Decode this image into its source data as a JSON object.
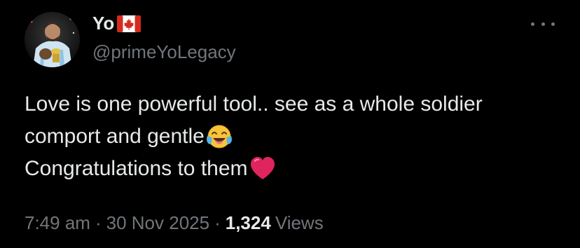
{
  "author": {
    "display_name": "Yo",
    "flag_icon": "canada-flag-icon",
    "handle": "@primeYoLegacy",
    "avatar_icon": "profile-photo"
  },
  "tweet": {
    "lines": [
      "Love is one powerful tool.. see as a whole soldier",
      "comport and gentle",
      "Congratulations to them"
    ],
    "emoji": [
      "tears-of-joy-emoji",
      "red-heart-emoji"
    ]
  },
  "meta": {
    "time": "7:49 am",
    "separator": "·",
    "date": "30 Nov 2025",
    "views_count": "1,324",
    "views_label": "Views"
  },
  "colors": {
    "background": "#000000",
    "primary_text": "#e7e9ea",
    "secondary_text": "#71767b",
    "heart": "#e0245e"
  }
}
